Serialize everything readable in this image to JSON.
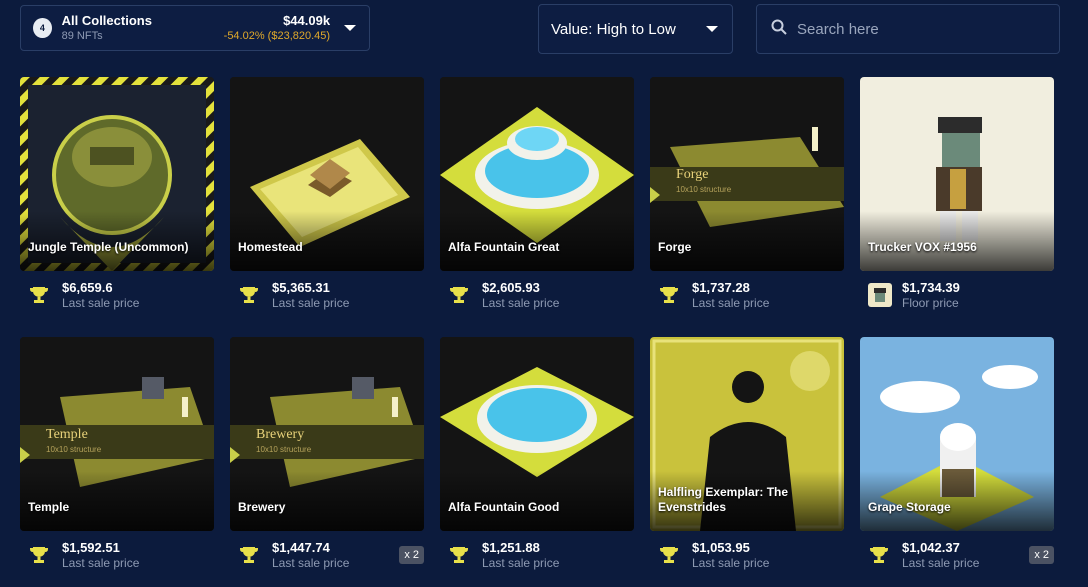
{
  "collection": {
    "count": "4",
    "title": "All Collections",
    "subtitle": "89 NFTs",
    "value": "$44.09k",
    "change": "-54.02% ($23,820.45)"
  },
  "sort": {
    "label": "Value: High to Low"
  },
  "search": {
    "placeholder": "Search here"
  },
  "items": [
    {
      "name": "Jungle Temple (Uncommon)",
      "price": "$6,659.6",
      "price_label": "Last sale price",
      "icon": "trophy-icon"
    },
    {
      "name": "Homestead",
      "price": "$5,365.31",
      "price_label": "Last sale price",
      "icon": "trophy-icon"
    },
    {
      "name": "Alfa Fountain Great",
      "price": "$2,605.93",
      "price_label": "Last sale price",
      "icon": "trophy-icon"
    },
    {
      "name": "Forge",
      "price": "$1,737.28",
      "price_label": "Last sale price",
      "icon": "trophy-icon",
      "caption": "Forge",
      "caption_sub": "10x10 structure"
    },
    {
      "name": "Trucker VOX #1956",
      "price": "$1,734.39",
      "price_label": "Floor price",
      "icon": "collection-avatar"
    },
    {
      "name": "Temple",
      "price": "$1,592.51",
      "price_label": "Last sale price",
      "icon": "trophy-icon",
      "caption": "Temple",
      "caption_sub": "10x10 structure"
    },
    {
      "name": "Brewery",
      "price": "$1,447.74",
      "price_label": "Last sale price",
      "icon": "trophy-icon",
      "qty": "x 2",
      "caption": "Brewery",
      "caption_sub": "10x10 structure"
    },
    {
      "name": "Alfa Fountain Good",
      "price": "$1,251.88",
      "price_label": "Last sale price",
      "icon": "trophy-icon"
    },
    {
      "name": "Halfling Exemplar: The Evenstrides",
      "price": "$1,053.95",
      "price_label": "Last sale price",
      "icon": "trophy-icon"
    },
    {
      "name": "Grape Storage",
      "price": "$1,042.37",
      "price_label": "Last sale price",
      "icon": "trophy-icon",
      "qty": "x 2"
    }
  ],
  "colors": {
    "background": "#0c1b3d",
    "accent_yellow": "#e0a92a",
    "muted_text": "#8e9ab3"
  }
}
